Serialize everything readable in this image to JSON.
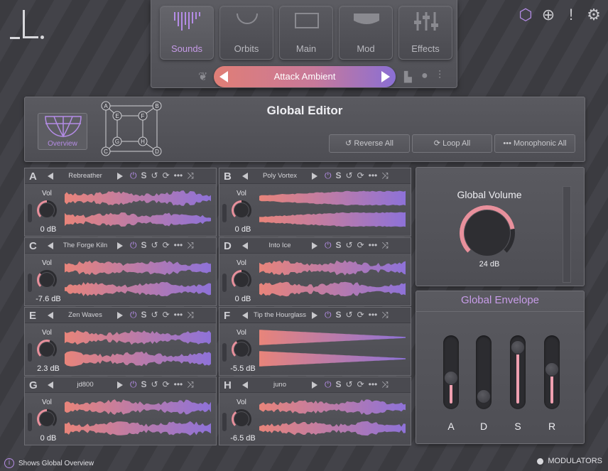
{
  "nav": {
    "tabs": [
      {
        "label": "Sounds",
        "active": true
      },
      {
        "label": "Orbits",
        "active": false
      },
      {
        "label": "Main",
        "active": false
      },
      {
        "label": "Mod",
        "active": false
      },
      {
        "label": "Effects",
        "active": false
      }
    ],
    "preset": "Attack Ambient"
  },
  "top_icons": [
    "cube-icon",
    "globe-icon",
    "alert-icon",
    "gear-icon"
  ],
  "editor": {
    "title": "Global Editor",
    "overview_label": "Overview",
    "grid_nodes": [
      "A",
      "B",
      "C",
      "D",
      "E",
      "F",
      "G",
      "H"
    ],
    "buttons": [
      {
        "icon": "↺",
        "label": "Reverse All"
      },
      {
        "icon": "⟳",
        "label": "Loop All"
      },
      {
        "icon": "•••",
        "label": "Monophonic All"
      }
    ]
  },
  "slots": [
    {
      "letter": "A",
      "name": "Rebreather",
      "vol_label": "Vol",
      "db": "0 dB",
      "level": 0.5
    },
    {
      "letter": "B",
      "name": "Poly Vortex",
      "vol_label": "Vol",
      "db": "0 dB",
      "level": 0.5
    },
    {
      "letter": "C",
      "name": "The Forge Kiln",
      "vol_label": "Vol",
      "db": "-7.6 dB",
      "level": 0.33
    },
    {
      "letter": "D",
      "name": "Into Ice",
      "vol_label": "Vol",
      "db": "0 dB",
      "level": 0.5
    },
    {
      "letter": "E",
      "name": "Zen Waves",
      "vol_label": "Vol",
      "db": "2.3 dB",
      "level": 0.57
    },
    {
      "letter": "F",
      "name": "Tip the Hourglass",
      "vol_label": "Vol",
      "db": "-5.5 dB",
      "level": 0.38
    },
    {
      "letter": "G",
      "name": "jd800",
      "vol_label": "Vol",
      "db": "0 dB",
      "level": 0.5
    },
    {
      "letter": "H",
      "name": "juno",
      "vol_label": "Vol",
      "db": "-6.5 dB",
      "level": 0.36
    }
  ],
  "slot_controls": {
    "solo": "S"
  },
  "global_volume": {
    "title": "Global Volume",
    "db": "24 dB",
    "level": 0.8
  },
  "global_envelope": {
    "title": "Global Envelope",
    "sliders": [
      {
        "label": "A",
        "level": 0.4
      },
      {
        "label": "D",
        "level": 0.1
      },
      {
        "label": "S",
        "level": 0.92
      },
      {
        "label": "R",
        "level": 0.55
      }
    ]
  },
  "status": {
    "text": "Shows Global Overview",
    "info_glyph": "i",
    "modulators": "MODULATORS"
  },
  "colors": {
    "accent": "#b48ce6",
    "wave_start": "#e8847a",
    "wave_end": "#8e72d8"
  }
}
